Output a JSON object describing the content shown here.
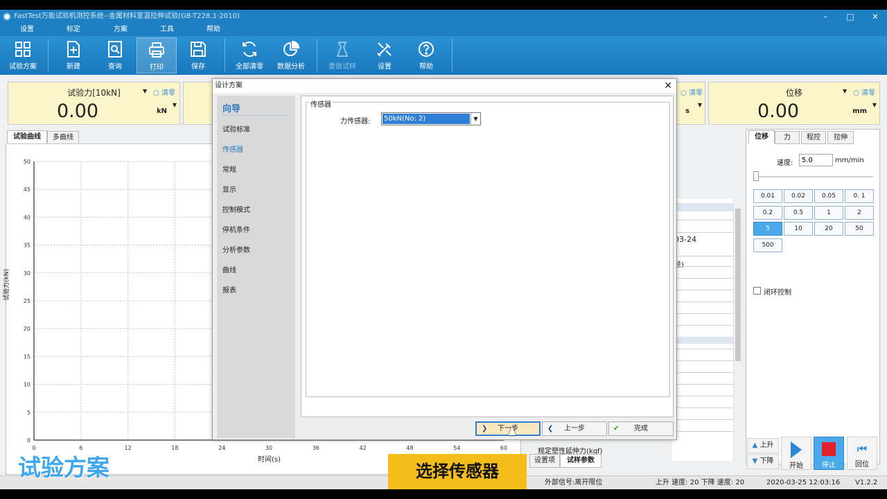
{
  "app_title": "FastTest万能试验机测控系统--金属材料室温拉伸试验(GB-T228.1-2010)",
  "menu": [
    "设置",
    "标定",
    "方案",
    "工具",
    "帮助"
  ],
  "toolbar": [
    "试验方案",
    "新建",
    "查询",
    "打印",
    "保存",
    "全部清零",
    "数据分析",
    "重做试样",
    "设置",
    "帮助"
  ],
  "meters": [
    {
      "label": "试验力[10kN]",
      "value": "0.00",
      "unit": "kN",
      "clear": "清零"
    },
    {
      "label": "",
      "value": "",
      "unit": "s",
      "clear": "清零"
    },
    {
      "label": "位移",
      "value": "0.00",
      "unit": "mm",
      "clear": "清零"
    }
  ],
  "chart_tabs": [
    "试验曲线",
    "多曲线"
  ],
  "chart_data": {
    "type": "line",
    "xlabel": "时间(s)",
    "ylabel": "试验力(kN)",
    "xlim": [
      0,
      60
    ],
    "ylim": [
      0,
      50
    ],
    "x_ticks": [
      "0",
      "6",
      "12",
      "18",
      "24",
      "30",
      "36",
      "42",
      "48",
      "54",
      "60"
    ],
    "y_ticks": [
      "0",
      "5",
      "10",
      "15",
      "20",
      "25",
      "30",
      "35",
      "40",
      "45",
      "50"
    ],
    "grid": true,
    "series": []
  },
  "right_panel": {
    "tabs": [
      "位移",
      "力",
      "程控",
      "拉伸"
    ],
    "speed_label": "速度:",
    "speed_value": "5.0",
    "speed_unit": "mm/min",
    "speed_buttons": [
      "0.01",
      "0.02",
      "0.05",
      "0. 1",
      "0.2",
      "0.5",
      "1",
      "2",
      "5",
      "10",
      "20",
      "50",
      "500"
    ],
    "selected_speed": "5",
    "closed_loop": "闭环控制",
    "controls": [
      "上升",
      "下降",
      "开始",
      "停止",
      "回位"
    ]
  },
  "mid_list": {
    "date_fragment": "03-24",
    "param_fragment": "径)",
    "last_row": "规定塑性延伸力(kqf)"
  },
  "bottom_tabs": [
    "设置项",
    "试样参数"
  ],
  "dialog": {
    "title": "设计方案",
    "nav_header": "向导",
    "nav_items": [
      "试验标准",
      "传感器",
      "常规",
      "显示",
      "控制模式",
      "停机条件",
      "分析参数",
      "曲线",
      "报表"
    ],
    "current": "传感器",
    "group_title": "传感器",
    "field_label": "力传感器:",
    "field_value": "50kN(No: 2)",
    "buttons": {
      "next": "下一步",
      "prev": "上一步",
      "finish": "完成"
    }
  },
  "status": {
    "signal": "外部信号:离开限位",
    "speeds": "上升 速度: 20 下降 速度: 20",
    "datetime": "2020-03-25 12:03:16",
    "version": "V1.2.2"
  },
  "overlay": {
    "left": "试验方案",
    "center": "选择传感器"
  }
}
